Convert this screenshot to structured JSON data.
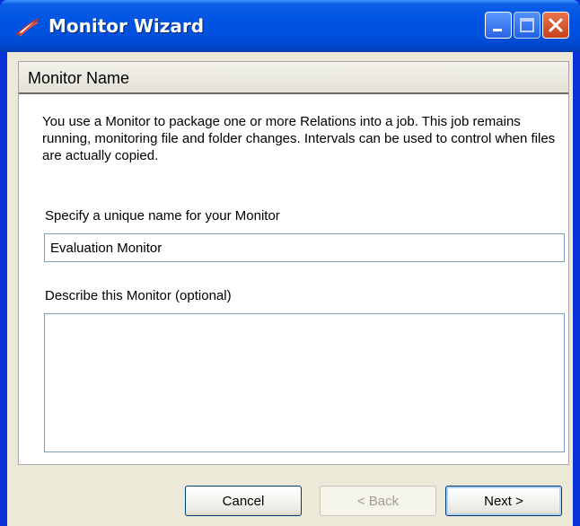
{
  "window": {
    "title": "Monitor Wizard",
    "icon": "wizard-app-icon",
    "controls": [
      "minimize-icon",
      "maximize-icon",
      "close-icon"
    ]
  },
  "panel": {
    "header": "Monitor Name",
    "description": "You use a Monitor to package one or more Relations into a job. This job remains running, monitoring file and folder changes. Intervals can be used to control when files are actually copied."
  },
  "fields": {
    "name_label": "Specify a unique name for your Monitor",
    "name_value": "Evaluation Monitor",
    "description_label": "Describe this Monitor (optional)",
    "description_value": ""
  },
  "buttons": {
    "cancel": "Cancel",
    "back": "< Back",
    "next": "Next >"
  },
  "colors": {
    "titlebar": "#0054e3",
    "dialog_bg": "#ece9d8",
    "input_border": "#7f9db9",
    "close_button": "#c6431c"
  }
}
